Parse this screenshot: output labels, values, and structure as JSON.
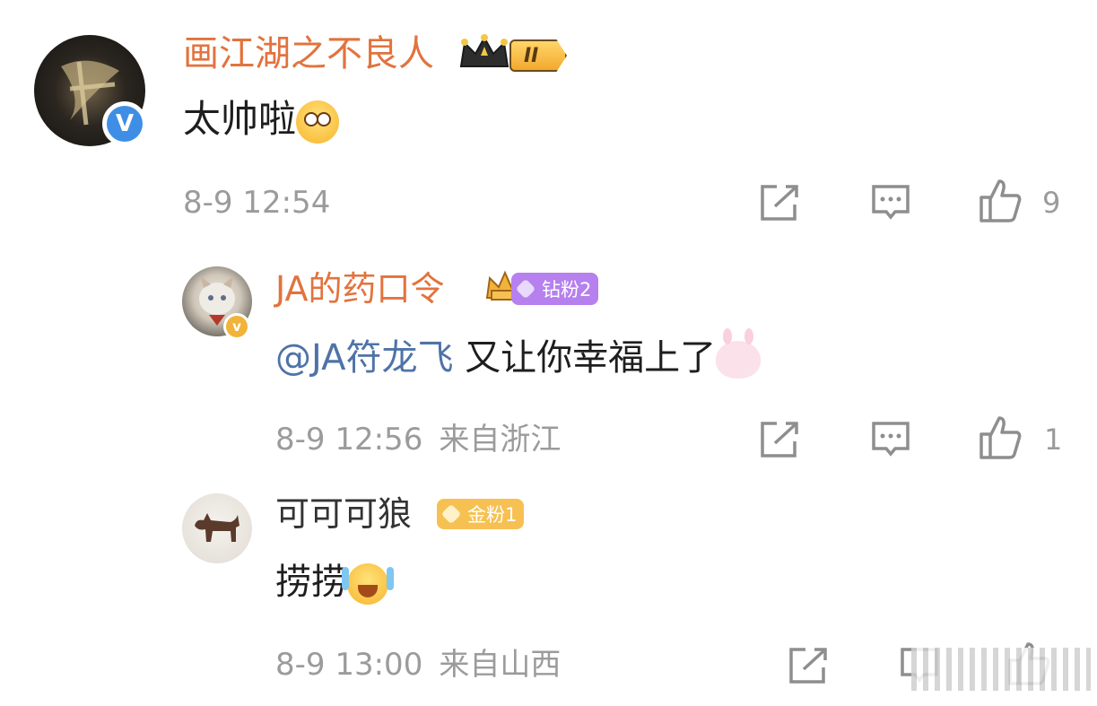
{
  "comments": [
    {
      "username": "画江湖之不良人",
      "rank_label": "II",
      "text": "太帅啦",
      "emoji": "wow-emoji",
      "timestamp": "8-9 12:54",
      "location": "",
      "likes": "9",
      "verified": "blue",
      "verify_mark": "V"
    },
    {
      "username": "JA的药口令",
      "fan_badge": "钻粉2",
      "mention": "@JA符龙飞",
      "text": " 又让你幸福上了",
      "emoji": "bunny-emoji",
      "timestamp": "8-9 12:56",
      "location": "来自浙江",
      "likes": "1",
      "verified": "gold",
      "verify_mark": "v"
    },
    {
      "username": "可可可狼",
      "fan_badge": "金粉1",
      "text": "捞捞",
      "emoji": "laugh-emoji",
      "timestamp": "8-9 13:00",
      "location": "来自山西",
      "likes": ""
    }
  ],
  "colors": {
    "username": "#e2733d",
    "mention": "#4e73a8",
    "meta": "#9b9b9b",
    "diamond_badge": "#b680ee",
    "gold_badge": "#f6c152",
    "verify_blue": "#3f8ee6",
    "verify_gold": "#f2b33a"
  }
}
